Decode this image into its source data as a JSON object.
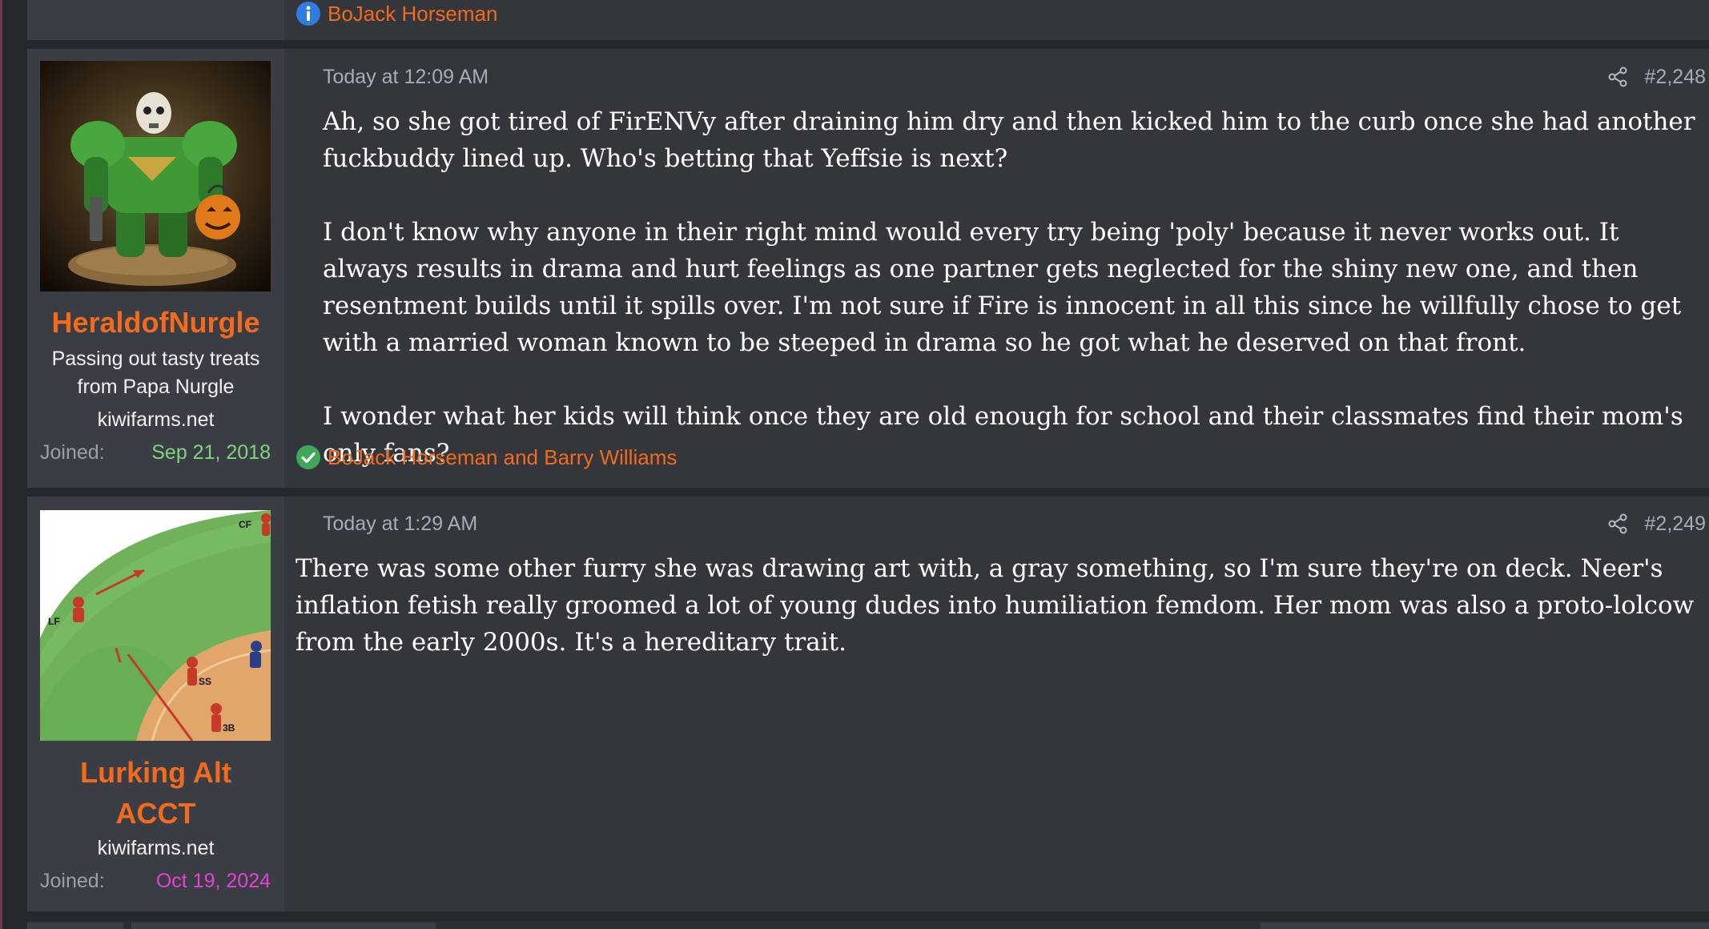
{
  "previous_post": {
    "reaction_text": "BoJack Horseman",
    "reaction_icon": "info-icon"
  },
  "posts": [
    {
      "username": "HeraldofNurgle",
      "user_title_line1": "Passing out tasty treats",
      "user_title_line2": "from Papa Nurgle",
      "site": "kiwifarms.net",
      "joined_label": "Joined:",
      "joined_date": "Sep 21, 2018",
      "joined_color": "#7ed67c",
      "timestamp": "Today at 12:09 AM",
      "post_number": "#2,248",
      "avatar_icon": "space-marine-avatar",
      "paragraphs": [
        "Ah, so she got tired of FirENVy after draining him dry and then kicked him to the curb once she had another fuckbuddy lined up. Who's betting that Yeffsie is next?",
        "I don't know why anyone in their right mind would every try being 'poly' because it never works out. It always results in drama and hurt feelings as one partner gets neglected for the shiny new one, and then resentment builds until it spills over. I'm not sure if Fire is innocent in all this since he willfully chose to get with a married woman known to be steeped in drama so he got what he deserved on that front.",
        "I wonder what her kids will think once they are old enough for school and their classmates find their mom's only fans?"
      ],
      "reactions_text": "BoJack Horseman and Barry Williams",
      "reaction_icon": "check-icon"
    },
    {
      "username": "Lurking Alt ACCT",
      "username_line1": "Lurking Alt",
      "username_line2": "ACCT",
      "site": "kiwifarms.net",
      "joined_label": "Joined:",
      "joined_date": "Oct 19, 2024",
      "joined_color": "#e83fd6",
      "timestamp": "Today at 1:29 AM",
      "post_number": "#2,249",
      "avatar_icon": "baseball-field-avatar",
      "avatar_labels": {
        "cf": "CF",
        "lf": "LF",
        "ss": "SS",
        "third": "3B"
      },
      "paragraphs": [
        "There was some other furry she was drawing art with, a gray something, so I'm sure they're on deck. Neer's inflation fetish really groomed a lot of young dudes into humiliation femdom. Her mom was also a proto-lolcow from the early 2000s. It's a hereditary trait."
      ]
    }
  ],
  "colors": {
    "accent": "#f26b1d",
    "panel": "#33373c",
    "user_panel": "#3a3e44",
    "background": "#25282c"
  }
}
